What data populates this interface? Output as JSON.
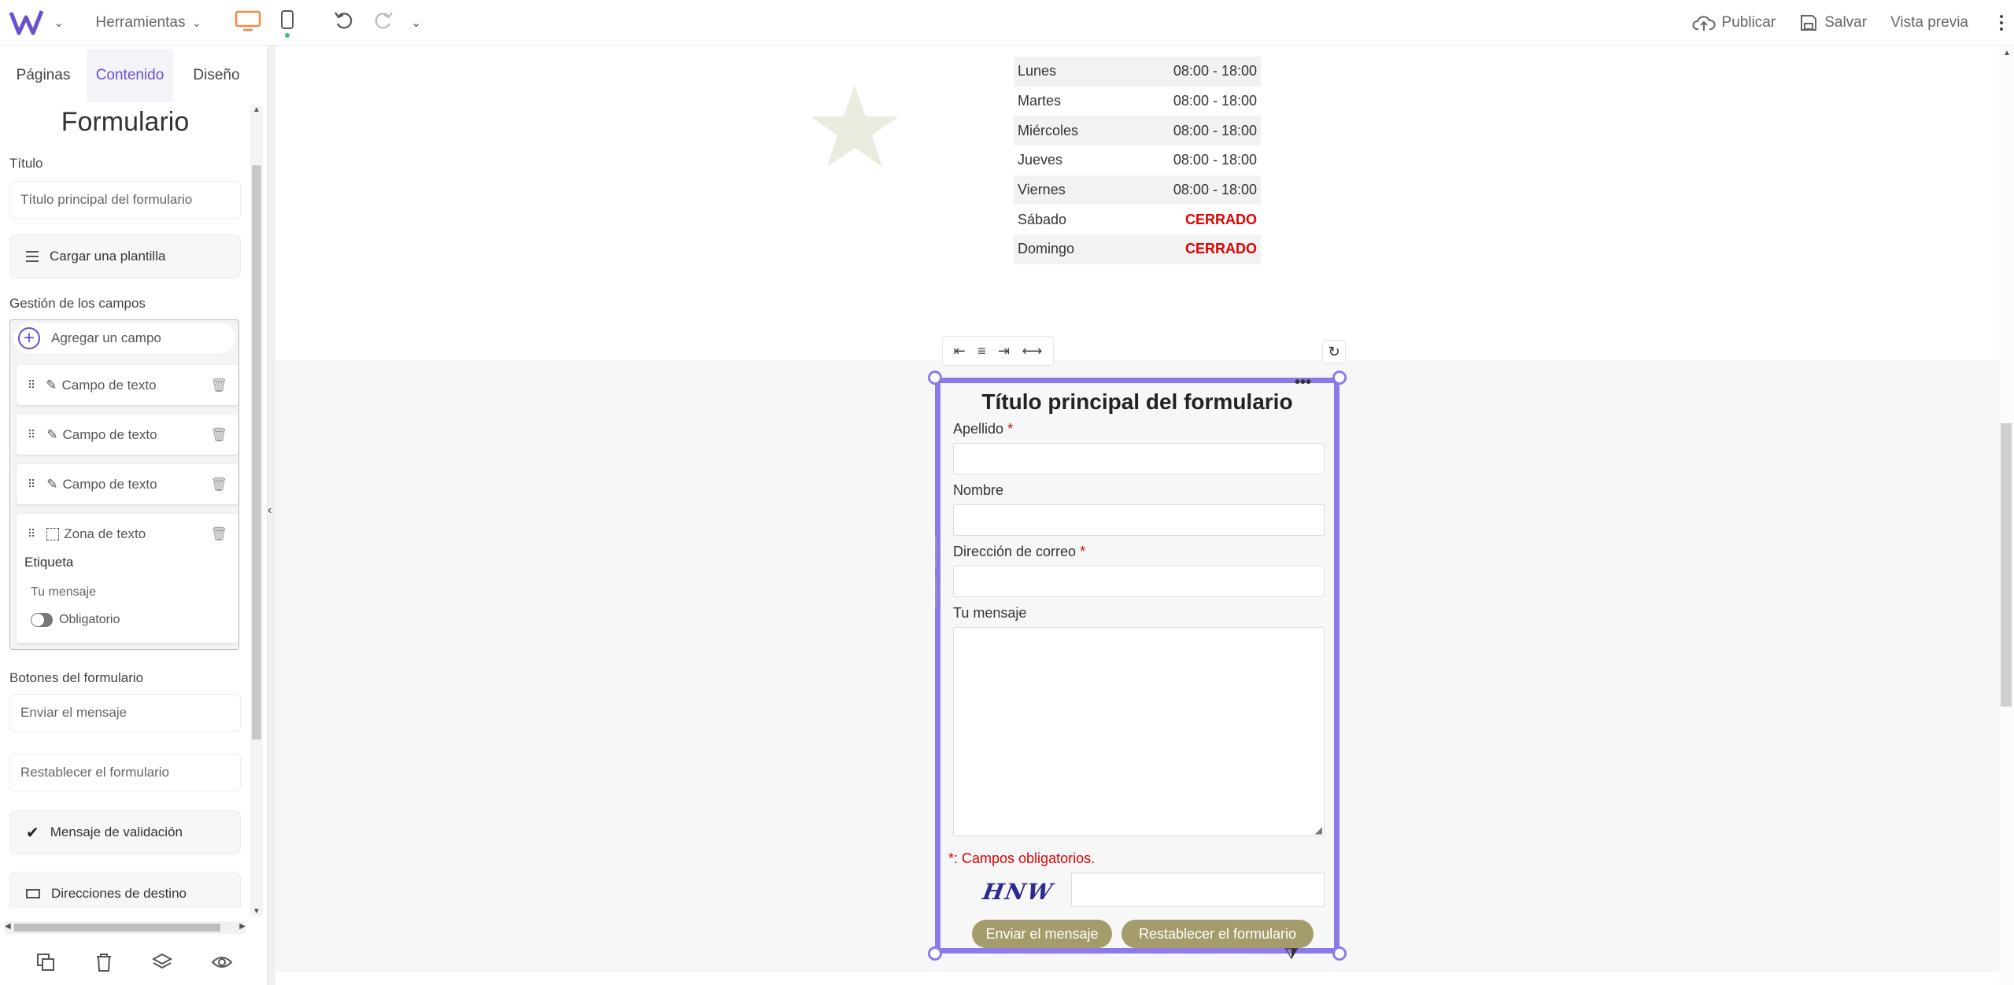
{
  "toolbar": {
    "tools_label": "Herramientas",
    "publish_label": "Publicar",
    "save_label": "Salvar",
    "preview_label": "Vista previa"
  },
  "sidebar": {
    "tabs": [
      {
        "label": "Páginas"
      },
      {
        "label": "Contenido"
      },
      {
        "label": "Diseño"
      }
    ],
    "heading": "Formulario",
    "title_label": "Título",
    "title_value": "Título principal del formulario",
    "template_button": "Cargar una plantilla",
    "fields_section": "Gestión de los campos",
    "add_field": "Agregar un campo",
    "fields": [
      {
        "label": "Campo de texto"
      },
      {
        "label": "Campo de texto"
      },
      {
        "label": "Campo de texto"
      },
      {
        "label": "Zona de texto"
      }
    ],
    "expanded_field": {
      "tag_label": "Etiqueta",
      "tag_value": "Tu mensaje",
      "required_label": "Obligatorio"
    },
    "buttons_section": "Botones del formulario",
    "send_value": "Enviar el mensaje",
    "reset_value": "Restablecer el formulario",
    "validation_button": "Mensaje de validación",
    "destinations_button": "Direcciones de destino"
  },
  "hours": [
    {
      "day": "Lunes",
      "time": "08:00 - 18:00",
      "closed": false
    },
    {
      "day": "Martes",
      "time": "08:00 - 18:00",
      "closed": false
    },
    {
      "day": "Miércoles",
      "time": "08:00 - 18:00",
      "closed": false
    },
    {
      "day": "Jueves",
      "time": "08:00 - 18:00",
      "closed": false
    },
    {
      "day": "Viernes",
      "time": "08:00 - 18:00",
      "closed": false
    },
    {
      "day": "Sábado",
      "time": "CERRADO",
      "closed": true
    },
    {
      "day": "Domingo",
      "time": "CERRADO",
      "closed": true
    }
  ],
  "form": {
    "title": "Título principal del formulario",
    "fields": {
      "lastname": "Apellido",
      "firstname": "Nombre",
      "email": "Dirección de correo",
      "message": "Tu mensaje",
      "asterisk": "*"
    },
    "required_note": "*: Campos obligatorios.",
    "captcha": "HNW",
    "send_button": "Enviar el mensaje",
    "reset_button": "Restablecer el formulario"
  },
  "colors": {
    "accent": "#6a4fd1",
    "selection": "#8b7be8",
    "button": "#a59c6b",
    "closed": "#e00000",
    "desktop_icon": "#f08a4b",
    "status_dot": "#2ecc71"
  }
}
